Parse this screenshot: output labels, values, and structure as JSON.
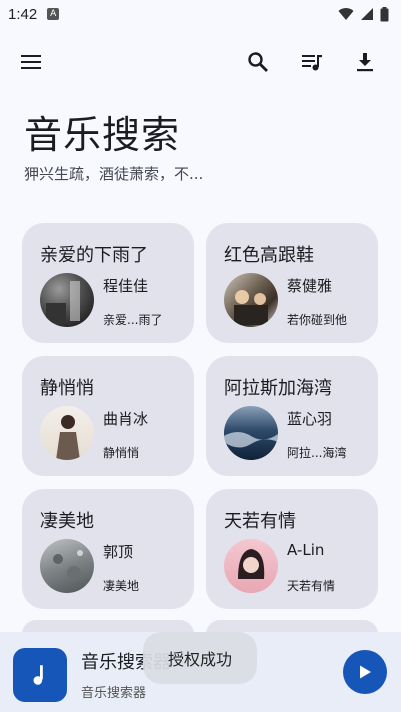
{
  "status_bar": {
    "time": "1:42"
  },
  "app_bar": {
    "icons": [
      "menu-icon",
      "search-icon",
      "playlist-icon",
      "download-icon"
    ]
  },
  "header": {
    "title": "音乐搜索",
    "subtitle": "狎兴生疏，酒徒萧索，不..."
  },
  "cards": [
    {
      "title": "亲爱的下雨了",
      "artist": "程佳佳",
      "sub": "亲爱...雨了",
      "cover": "bw-street"
    },
    {
      "title": "红色高跟鞋",
      "artist": "蔡健雅",
      "sub": "若你碰到他",
      "cover": "crowd"
    },
    {
      "title": "静悄悄",
      "artist": "曲肖冰",
      "sub": "静悄悄",
      "cover": "portrait-girl"
    },
    {
      "title": "阿拉斯加海湾",
      "artist": "蓝心羽",
      "sub": "阿拉...海湾",
      "cover": "sea-waves"
    },
    {
      "title": "凄美地",
      "artist": "郭顶",
      "sub": "凄美地",
      "cover": "grey-terrain"
    },
    {
      "title": "天若有情",
      "artist": "A-Lin",
      "sub": "天若有情",
      "cover": "pink-portrait"
    }
  ],
  "mini_player": {
    "title": "音乐搜索器",
    "subtitle": "音乐搜索器"
  },
  "toast": {
    "text": "授权成功"
  },
  "colors": {
    "accent": "#1656b8",
    "card_bg": "#e1e2ec",
    "background": "#f7f9ff"
  }
}
